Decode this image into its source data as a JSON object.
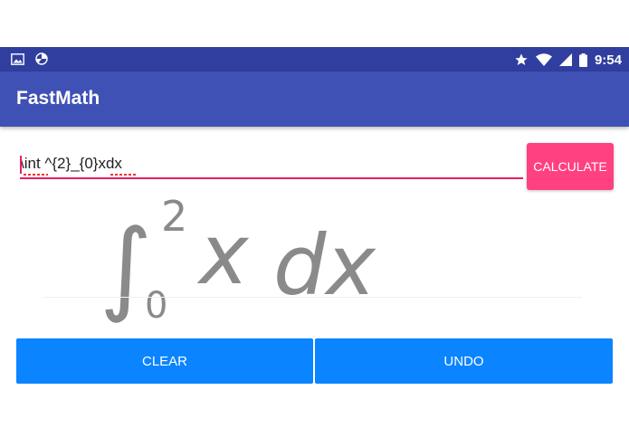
{
  "status_bar": {
    "time": "9:54",
    "left_icons": [
      "image-icon",
      "app-notification-icon"
    ],
    "right_icons": [
      "star-icon",
      "wifi-icon",
      "signal-icon",
      "battery-icon"
    ]
  },
  "app_bar": {
    "title": "FastMath"
  },
  "input": {
    "value": "\\int ^{2}_{0}xdx"
  },
  "calculate_button": {
    "label": "CALCULATE"
  },
  "formula_render": {
    "integral": "∫",
    "upper_limit": "2",
    "lower_limit": "0",
    "integrand": "x",
    "differential": "dx"
  },
  "buttons": {
    "clear_label": "CLEAR",
    "undo_label": "UNDO"
  },
  "colors": {
    "status_bar": "#303f9f",
    "app_bar": "#3f51b5",
    "accent": "#ff4081",
    "input_line": "#e91e63",
    "button_blue": "#0a84ff",
    "formula_gray": "#8a8a8a"
  }
}
